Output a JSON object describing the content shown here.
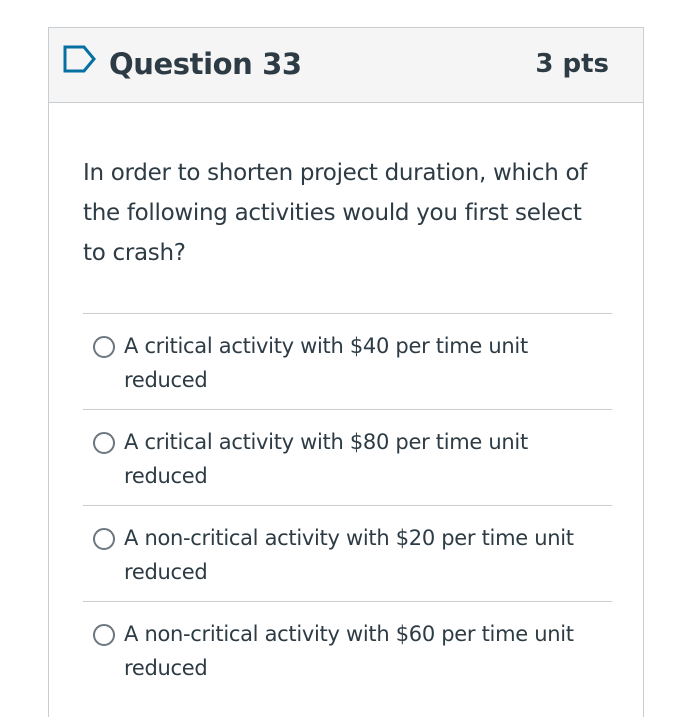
{
  "question": {
    "title": "Question 33",
    "points": "3 pts",
    "text": "In order to shorten project duration, which of the following activities would you first select to crash?",
    "flag_icon": "flag-outline-icon"
  },
  "answers": [
    {
      "label": "A critical activity with $40 per time unit reduced",
      "selected": false
    },
    {
      "label": "A critical activity with $80 per time unit reduced",
      "selected": false
    },
    {
      "label": "A non-critical activity with $20 per time unit reduced",
      "selected": false
    },
    {
      "label": "A non-critical activity with $60 per time unit reduced",
      "selected": false
    }
  ],
  "colors": {
    "text": "#2d3b45",
    "header_bg": "#f5f5f5",
    "border": "#c7cdd1",
    "flag": "#0770a3"
  }
}
